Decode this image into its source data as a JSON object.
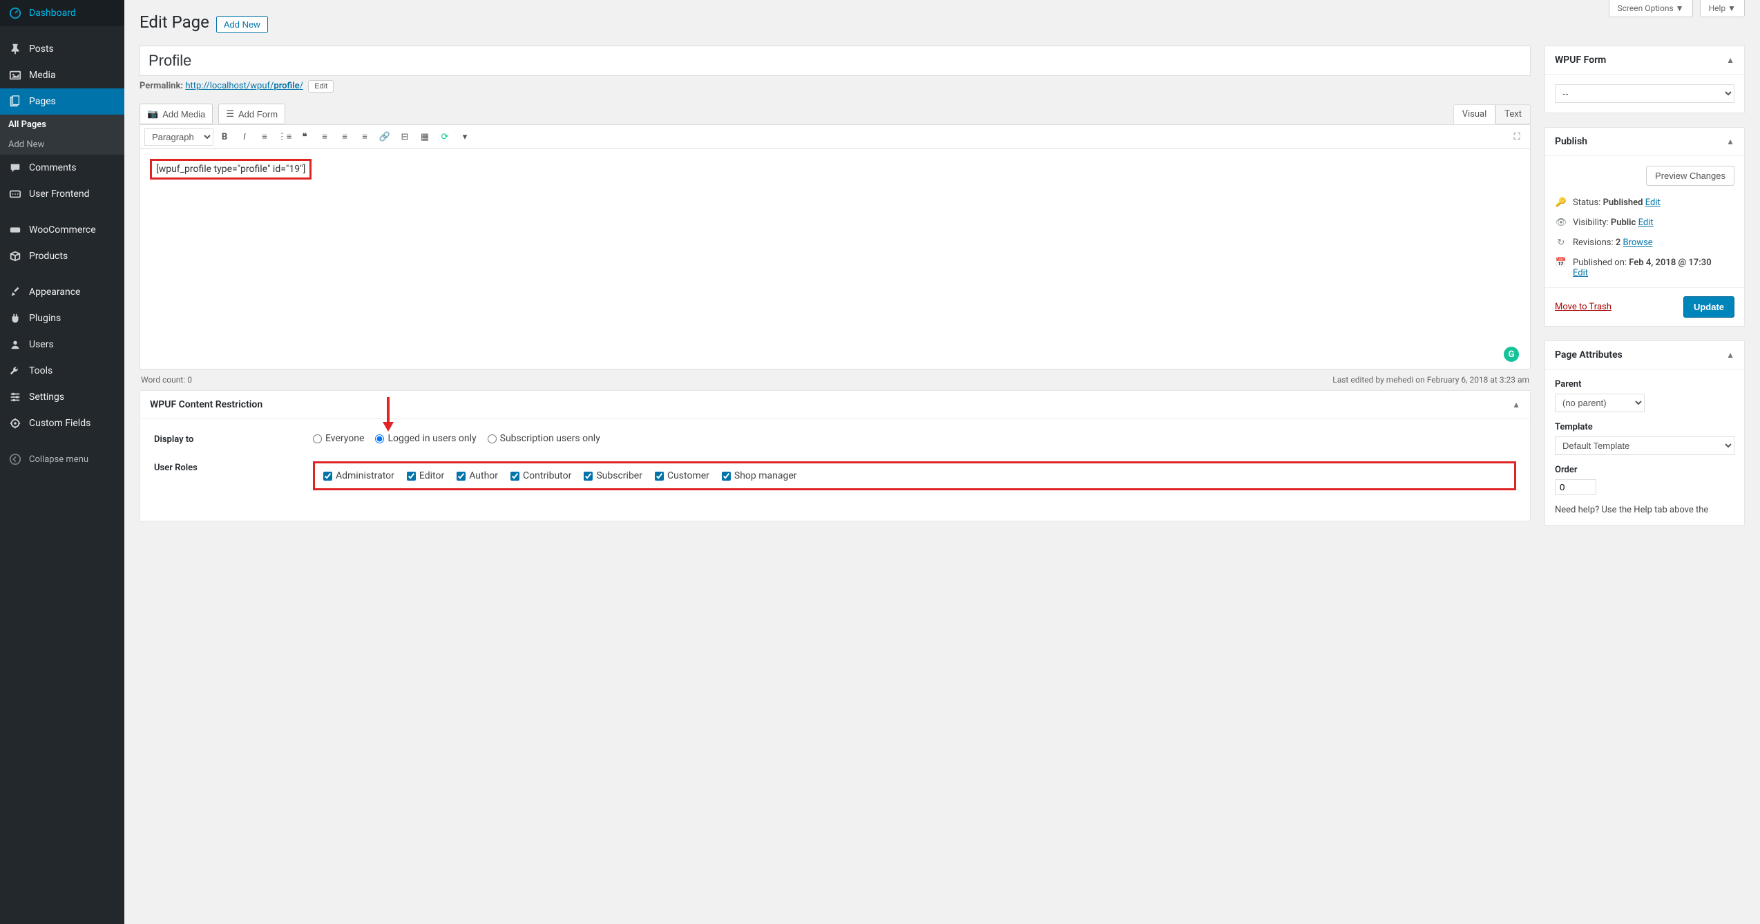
{
  "screen_tabs": {
    "options": "Screen Options ▼",
    "help": "Help ▼"
  },
  "sidebar": {
    "items": [
      {
        "label": "Dashboard",
        "icon": "dashboard"
      },
      {
        "label": "Posts",
        "icon": "pin"
      },
      {
        "label": "Media",
        "icon": "media"
      },
      {
        "label": "Pages",
        "icon": "pages",
        "current": true
      },
      {
        "label": "Comments",
        "icon": "comment"
      },
      {
        "label": "User Frontend",
        "icon": "frontend"
      },
      {
        "label": "WooCommerce",
        "icon": "woo"
      },
      {
        "label": "Products",
        "icon": "products"
      },
      {
        "label": "Appearance",
        "icon": "appearance"
      },
      {
        "label": "Plugins",
        "icon": "plugins"
      },
      {
        "label": "Users",
        "icon": "users"
      },
      {
        "label": "Tools",
        "icon": "tools"
      },
      {
        "label": "Settings",
        "icon": "settings"
      },
      {
        "label": "Custom Fields",
        "icon": "custom"
      }
    ],
    "submenu": [
      {
        "label": "All Pages",
        "active": true
      },
      {
        "label": "Add New"
      }
    ],
    "collapse": "Collapse menu"
  },
  "page": {
    "heading": "Edit Page",
    "add_new": "Add New",
    "title_value": "Profile",
    "permalink_label": "Permalink:",
    "permalink_base": "http://localhost/wpuf/",
    "permalink_slug": "profile",
    "permalink_tail": "/",
    "edit_btn": "Edit"
  },
  "editor": {
    "add_media": "Add Media",
    "add_form": "Add Form",
    "tab_visual": "Visual",
    "tab_text": "Text",
    "format_sel": "Paragraph",
    "content_shortcode": "[wpuf_profile type=\"profile\" id=\"19\"]",
    "word_count_label": "Word count:",
    "word_count_value": "0",
    "last_edited": "Last edited by mehedi on February 6, 2018 at 3:23 am"
  },
  "restriction": {
    "box_title": "WPUF Content Restriction",
    "display_label": "Display to",
    "options": {
      "everyone": "Everyone",
      "logged_in": "Logged in users only",
      "subscription": "Subscription users only"
    },
    "selected": "logged_in",
    "roles_label": "User Roles",
    "roles": [
      "Administrator",
      "Editor",
      "Author",
      "Contributor",
      "Subscriber",
      "Customer",
      "Shop manager"
    ]
  },
  "wpuf_form_box": {
    "title": "WPUF Form",
    "selected": "--"
  },
  "publish": {
    "title": "Publish",
    "preview": "Preview Changes",
    "status_label": "Status:",
    "status_value": "Published",
    "status_edit": "Edit",
    "visibility_label": "Visibility:",
    "visibility_value": "Public",
    "visibility_edit": "Edit",
    "revisions_label": "Revisions:",
    "revisions_value": "2",
    "revisions_browse": "Browse",
    "published_label": "Published on:",
    "published_value": "Feb 4, 2018 @ 17:30",
    "published_edit": "Edit",
    "trash": "Move to Trash",
    "update": "Update"
  },
  "attributes": {
    "title": "Page Attributes",
    "parent_label": "Parent",
    "parent_value": "(no parent)",
    "template_label": "Template",
    "template_value": "Default Template",
    "order_label": "Order",
    "order_value": "0",
    "help": "Need help? Use the Help tab above the"
  }
}
